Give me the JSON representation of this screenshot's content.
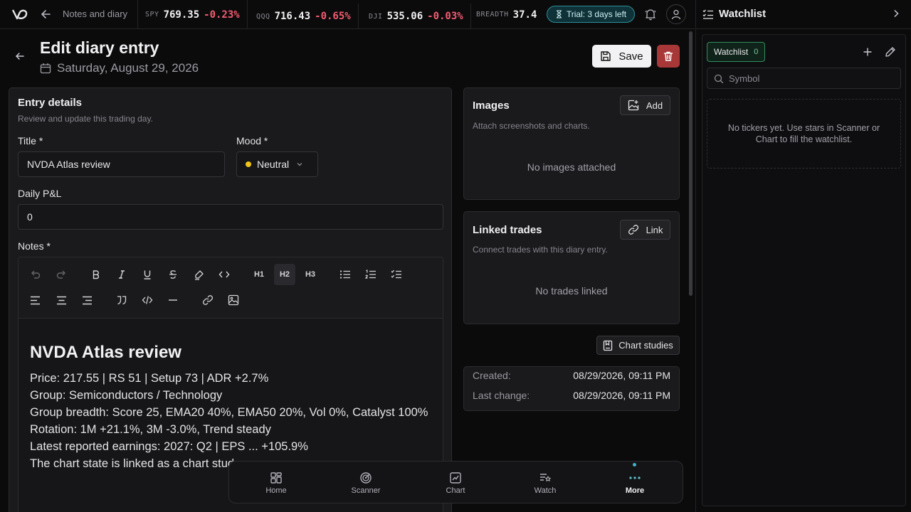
{
  "header": {
    "breadcrumb": "Notes and diary",
    "tickers": [
      {
        "symbol": "SPY",
        "price": "769.35",
        "change": "-0.23%"
      },
      {
        "symbol": "QQQ",
        "price": "716.43",
        "change": "-0.65%"
      },
      {
        "symbol": "DJI",
        "price": "535.06",
        "change": "-0.03%"
      },
      {
        "symbol": "BREADTH",
        "price": "37.4",
        "change": ""
      }
    ],
    "trial_label": "Trial: 3 days left"
  },
  "page": {
    "title": "Edit diary entry",
    "date": "Saturday, August 29, 2026",
    "save_label": "Save"
  },
  "entry": {
    "heading": "Entry details",
    "subheading": "Review and update this trading day.",
    "title_label": "Title *",
    "title_value": "NVDA Atlas review",
    "mood_label": "Mood *",
    "mood_value": "Neutral",
    "pnl_label": "Daily P&L",
    "pnl_value": "0",
    "notes_label": "Notes *",
    "toolbar": {
      "h1": "H1",
      "h2": "H2",
      "h3": "H3"
    },
    "doc": {
      "heading": "NVDA Atlas review",
      "lines": [
        "Price: 217.55 | RS 51 | Setup 73 | ADR +2.7%",
        "Group: Semiconductors / Technology",
        "Group breadth: Score 25, EMA20 40%, EMA50 20%, Vol 0%, Catalyst 100%",
        "Rotation: 1M +21.1%, 3M -3.0%, Trend steady",
        "Latest reported earnings: 2027: Q2 | EPS ... +105.9%",
        "The chart state is linked as a chart study."
      ]
    }
  },
  "images": {
    "title": "Images",
    "subtitle": "Attach screenshots and charts.",
    "add_label": "Add",
    "empty": "No images attached"
  },
  "linked_trades": {
    "title": "Linked trades",
    "subtitle": "Connect trades with this diary entry.",
    "link_label": "Link",
    "empty": "No trades linked"
  },
  "chart_studies_label": "Chart studies",
  "meta": {
    "created_label": "Created:",
    "created_value": "08/29/2026, 09:11 PM",
    "changed_label": "Last change:",
    "changed_value": "08/29/2026, 09:11 PM"
  },
  "nav": {
    "items": [
      {
        "label": "Home",
        "icon": "grid-icon"
      },
      {
        "label": "Scanner",
        "icon": "radar-icon"
      },
      {
        "label": "Chart",
        "icon": "chart-icon"
      },
      {
        "label": "Watch",
        "icon": "watch-list-icon"
      },
      {
        "label": "More",
        "icon": "more-icon"
      }
    ]
  },
  "watchlist": {
    "title": "Watchlist",
    "tab_label": "Watchlist",
    "tab_count": "0",
    "search_placeholder": "Symbol",
    "empty": "No tickers yet. Use stars in Scanner or Chart to fill the watchlist."
  },
  "colors": {
    "negative": "#f25c70",
    "accent": "#3fb4c4",
    "danger": "#a83838",
    "mood": "#f0c419"
  }
}
